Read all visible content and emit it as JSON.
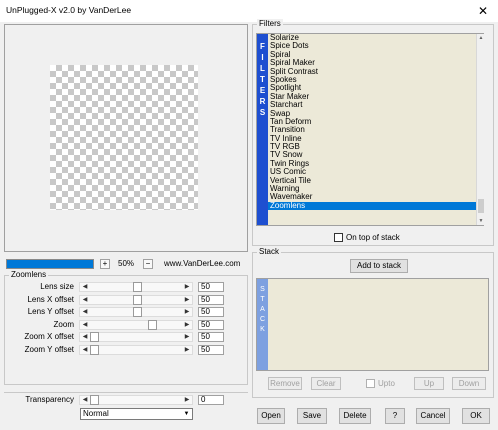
{
  "window": {
    "title": "UnPlugged-X v2.0 by VanDerLee",
    "close_glyph": "✕"
  },
  "filters": {
    "group_label": "Filters",
    "side_letters": [
      "F",
      "I",
      "L",
      "T",
      "E",
      "R",
      "S"
    ],
    "items": [
      "Solarize",
      "Spice Dots",
      "Spiral",
      "Spiral Maker",
      "Split Contrast",
      "Spokes",
      "Spotlight",
      "Star Maker",
      "Starchart",
      "Swap",
      "Tan Deform",
      "Transition",
      "TV Inline",
      "TV RGB",
      "TV Snow",
      "Twin Rings",
      "US Comic",
      "Vertical Tile",
      "Warning",
      "Wavemaker",
      "Zoomlens"
    ],
    "selected": "Zoomlens",
    "on_top_label": "On top of stack"
  },
  "preview": {
    "zoom_minus": "+",
    "zoom_value": "50%",
    "zoom_plus": "−",
    "website": "www.VanDerLee.com",
    "zoom_fill_percent": 100
  },
  "zoomlens": {
    "group_label": "Zoomlens",
    "params": [
      {
        "label": "Lens size",
        "value": "50",
        "level_percent": 50
      },
      {
        "label": "Lens X offset",
        "value": "50",
        "level_percent": 50
      },
      {
        "label": "Lens Y offset",
        "value": "50",
        "level_percent": 50
      },
      {
        "label": "Zoom",
        "value": "50",
        "level_percent": 68
      },
      {
        "label": "Zoom X offset",
        "value": "50",
        "level_percent": 0
      },
      {
        "label": "Zoom Y offset",
        "value": "50",
        "level_percent": 0
      }
    ]
  },
  "blend": {
    "transparency_label": "Transparency",
    "transparency_value": "0",
    "mode": "Normal"
  },
  "stack": {
    "group_label": "Stack",
    "add_label": "Add to stack",
    "side_letters": [
      "S",
      "T",
      "A",
      "C",
      "K"
    ],
    "remove_label": "Remove",
    "clear_label": "Clear",
    "upto_label": "Upto",
    "up_label": "Up",
    "down_label": "Down"
  },
  "footer": {
    "open_label": "Open",
    "save_label": "Save",
    "delete_label": "Delete",
    "help_label": "?",
    "cancel_label": "Cancel",
    "ok_label": "OK"
  }
}
